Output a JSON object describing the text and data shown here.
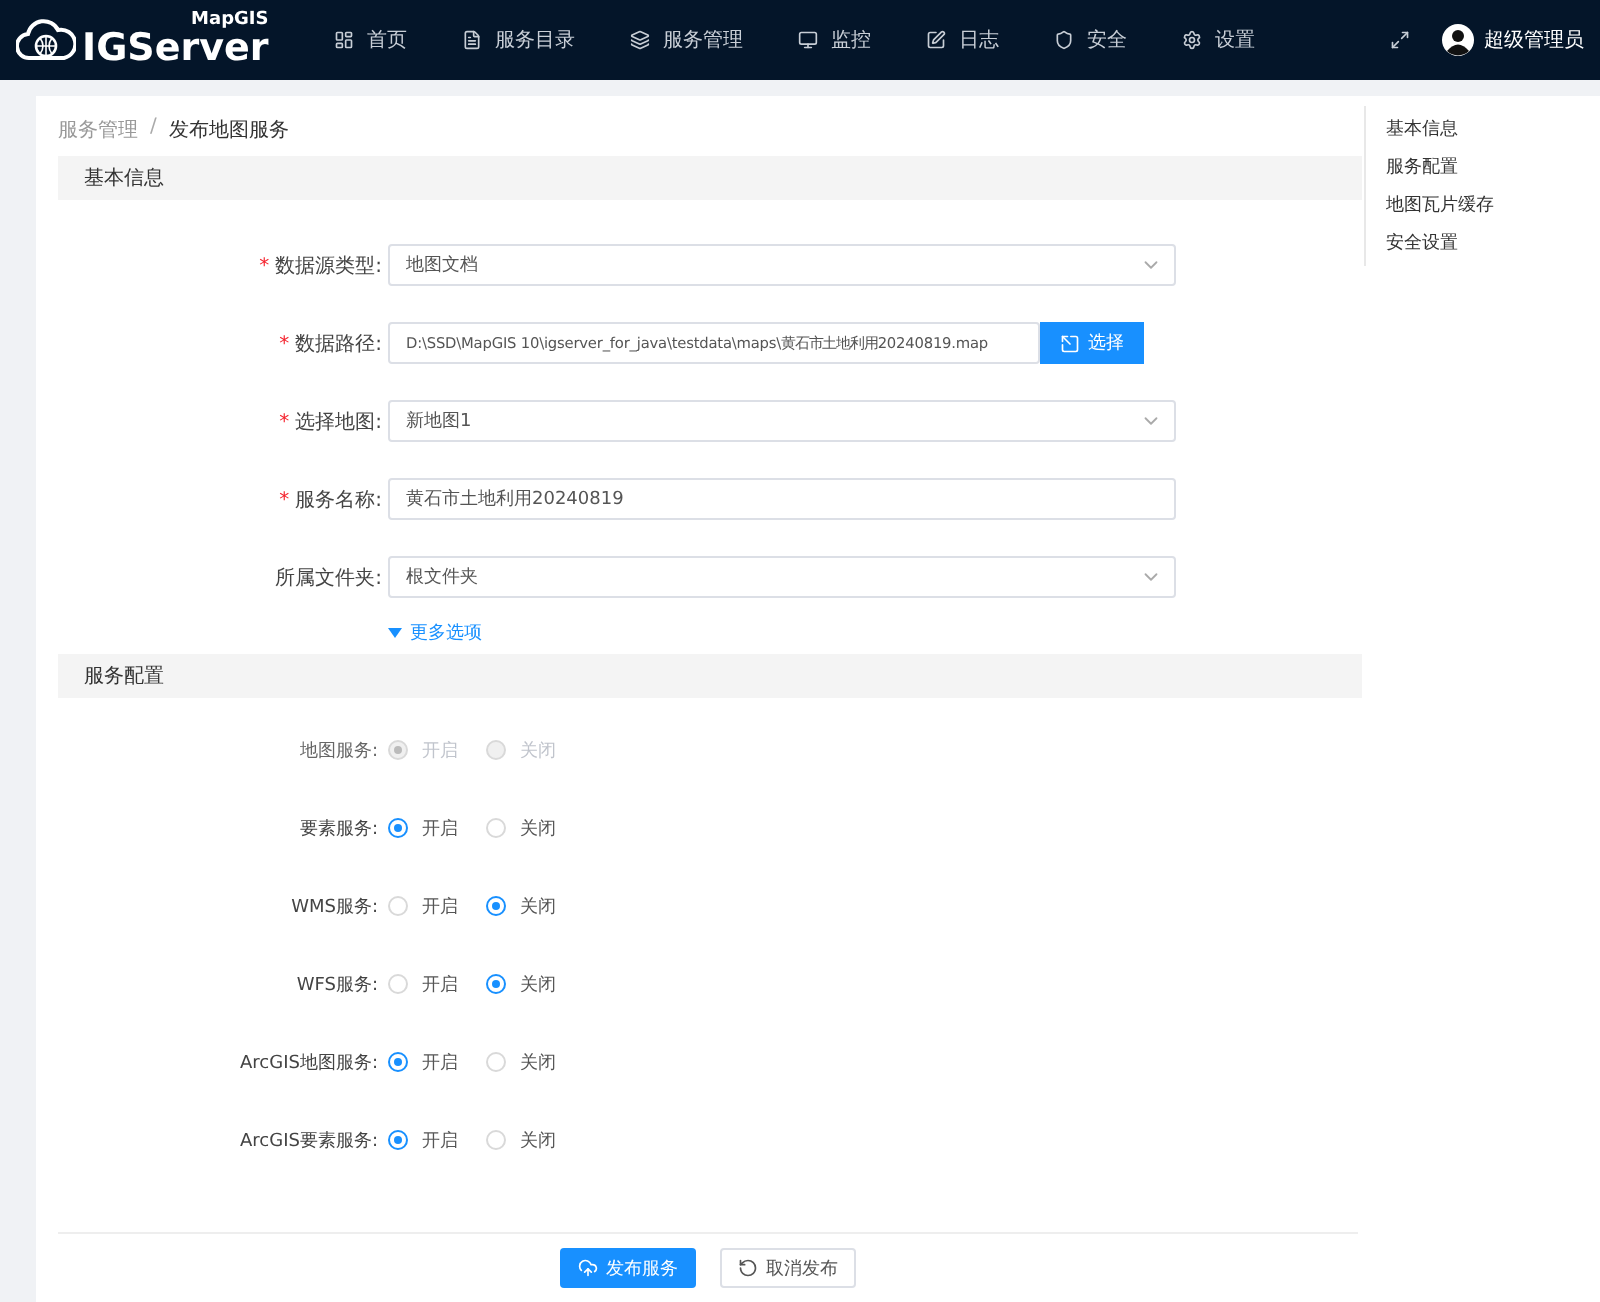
{
  "header": {
    "logo_small": "MapGIS",
    "logo_big": "IGServer",
    "nav": [
      {
        "label": "首页"
      },
      {
        "label": "服务目录"
      },
      {
        "label": "服务管理"
      },
      {
        "label": "监控"
      },
      {
        "label": "日志"
      },
      {
        "label": "安全"
      },
      {
        "label": "设置"
      }
    ],
    "user": "超级管理员"
  },
  "breadcrumb": [
    "服务管理",
    "发布地图服务"
  ],
  "required_mark": "*",
  "separator": "/",
  "anchors": [
    {
      "label": "基本信息"
    },
    {
      "label": "服务配置"
    },
    {
      "label": "地图瓦片缓存"
    },
    {
      "label": "安全设置"
    }
  ],
  "basic": {
    "title": "基本信息",
    "fields": [
      {
        "label": "数据源类型:",
        "required": true,
        "kind": "select",
        "value": "地图文档"
      },
      {
        "label": "数据路径:",
        "required": true,
        "kind": "path",
        "value": "D:\\SSD\\MapGIS 10\\igserver_for_java\\testdata\\maps\\黄石市土地利用20240819.map",
        "button": "选择"
      },
      {
        "label": "选择地图:",
        "required": true,
        "kind": "select",
        "value": "新地图1"
      },
      {
        "label": "服务名称:",
        "required": true,
        "kind": "text",
        "value": "黄石市土地利用20240819"
      },
      {
        "label": "所属文件夹:",
        "required": false,
        "kind": "select",
        "value": "根文件夹"
      }
    ],
    "more": "更多选项"
  },
  "config": {
    "title": "服务配置",
    "rows": [
      {
        "label": "地图服务:",
        "disabled": true,
        "options": [
          {
            "label": "开启",
            "selected": true
          },
          {
            "label": "关闭",
            "selected": false
          }
        ]
      },
      {
        "label": "要素服务:",
        "disabled": false,
        "options": [
          {
            "label": "开启",
            "selected": true
          },
          {
            "label": "关闭",
            "selected": false
          }
        ]
      },
      {
        "label": "WMS服务:",
        "disabled": false,
        "options": [
          {
            "label": "开启",
            "selected": false
          },
          {
            "label": "关闭",
            "selected": true
          }
        ]
      },
      {
        "label": "WFS服务:",
        "disabled": false,
        "options": [
          {
            "label": "开启",
            "selected": false
          },
          {
            "label": "关闭",
            "selected": true
          }
        ]
      },
      {
        "label": "ArcGIS地图服务:",
        "disabled": false,
        "options": [
          {
            "label": "开启",
            "selected": true
          },
          {
            "label": "关闭",
            "selected": false
          }
        ]
      },
      {
        "label": "ArcGIS要素服务:",
        "disabled": false,
        "options": [
          {
            "label": "开启",
            "selected": true
          },
          {
            "label": "关闭",
            "selected": false
          }
        ]
      }
    ]
  },
  "footer": {
    "publish": "发布服务",
    "cancel": "取消发布"
  }
}
